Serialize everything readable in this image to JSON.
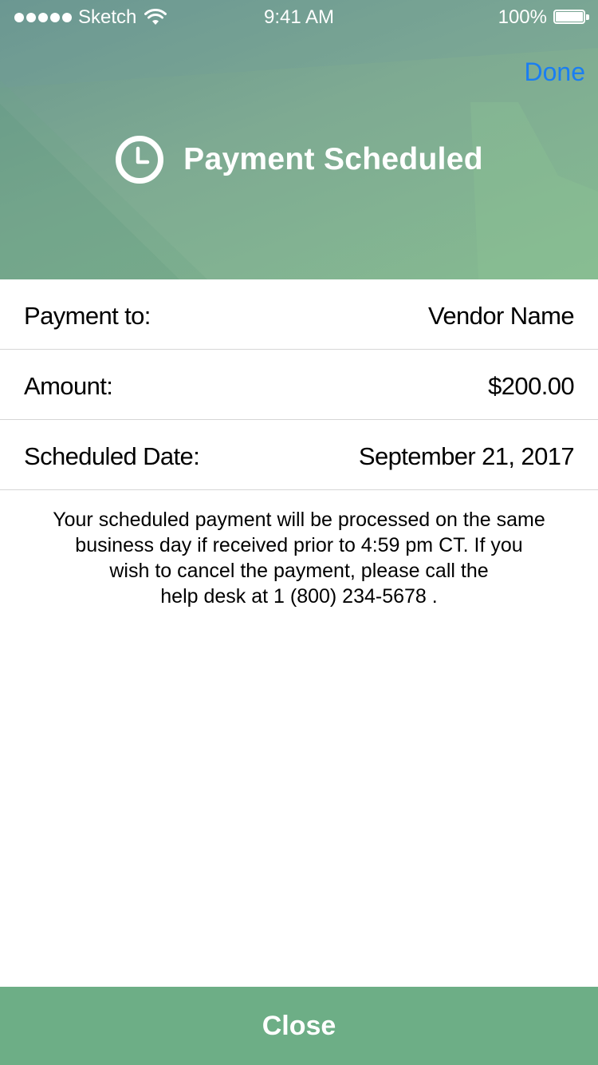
{
  "status_bar": {
    "carrier": "Sketch",
    "time": "9:41 AM",
    "battery": "100%"
  },
  "header": {
    "done_label": "Done",
    "title": "Payment Scheduled",
    "icon": "clock-icon",
    "accent_color": "#1a7ef2",
    "background_color": "#7eaa92"
  },
  "details": [
    {
      "label": "Payment to:",
      "value": "Vendor Name"
    },
    {
      "label": "Amount:",
      "value": "$200.00"
    },
    {
      "label": "Scheduled Date:",
      "value": "September 21, 2017"
    }
  ],
  "info": {
    "lines": [
      "Your scheduled payment will be processed on the same",
      "business day if received prior to 4:59 pm CT. If you",
      "wish to cancel the payment, please call the",
      "help desk at 1 (800) 234-5678 ."
    ]
  },
  "footer": {
    "close_label": "Close",
    "button_color": "#6dae86"
  }
}
